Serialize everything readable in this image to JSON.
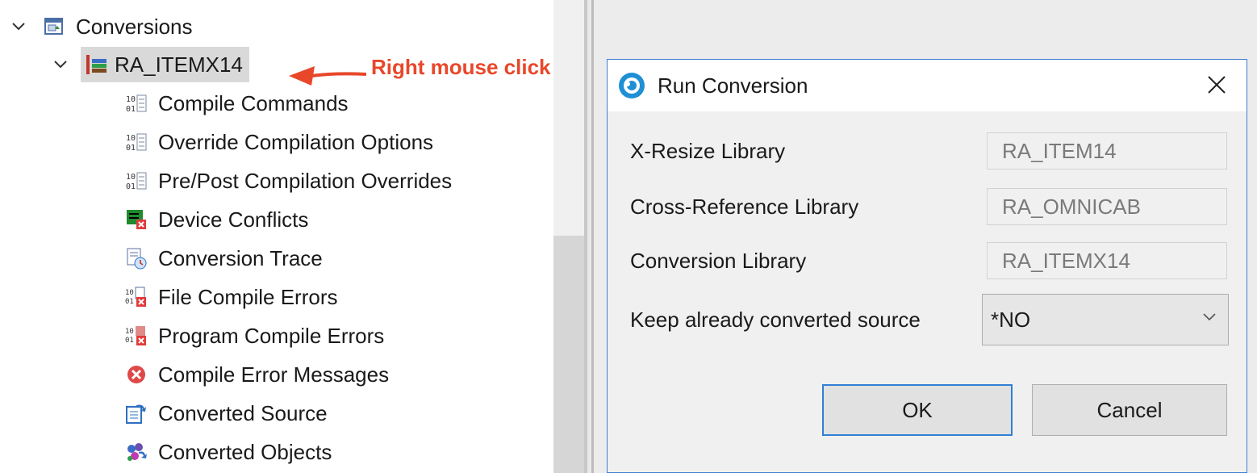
{
  "tree": {
    "root": {
      "label": "Conversions",
      "icon": "conversions-folder-icon"
    },
    "selected": {
      "label": "RA_ITEMX14",
      "icon": "library-icon"
    },
    "children": [
      {
        "label": "Compile Commands",
        "icon": "binary-list-icon"
      },
      {
        "label": "Override Compilation Options",
        "icon": "binary-list-icon"
      },
      {
        "label": "Pre/Post Compilation Overrides",
        "icon": "binary-list-icon"
      },
      {
        "label": "Device Conflicts",
        "icon": "device-conflict-icon"
      },
      {
        "label": "Conversion Trace",
        "icon": "trace-icon"
      },
      {
        "label": "File Compile Errors",
        "icon": "file-error-icon"
      },
      {
        "label": "Program Compile Errors",
        "icon": "program-error-icon"
      },
      {
        "label": "Compile Error Messages",
        "icon": "error-circle-icon"
      },
      {
        "label": "Converted Source",
        "icon": "converted-source-icon"
      },
      {
        "label": "Converted Objects",
        "icon": "converted-objects-icon"
      }
    ]
  },
  "annotation": {
    "text": "Right mouse click",
    "color": "#e8472a"
  },
  "dialog": {
    "title": "Run Conversion",
    "fields": [
      {
        "label": "X-Resize Library",
        "value": "RA_ITEM14"
      },
      {
        "label": "Cross-Reference Library",
        "value": "RA_OMNICAB"
      },
      {
        "label": "Conversion Library",
        "value": "RA_ITEMX14"
      }
    ],
    "keep_label": "Keep already converted source",
    "keep_value": "*NO",
    "ok_label": "OK",
    "cancel_label": "Cancel"
  },
  "colors": {
    "accent": "#2f7fd4",
    "selection": "#d9d9d9",
    "dialog_body": "#f0f0f0"
  }
}
